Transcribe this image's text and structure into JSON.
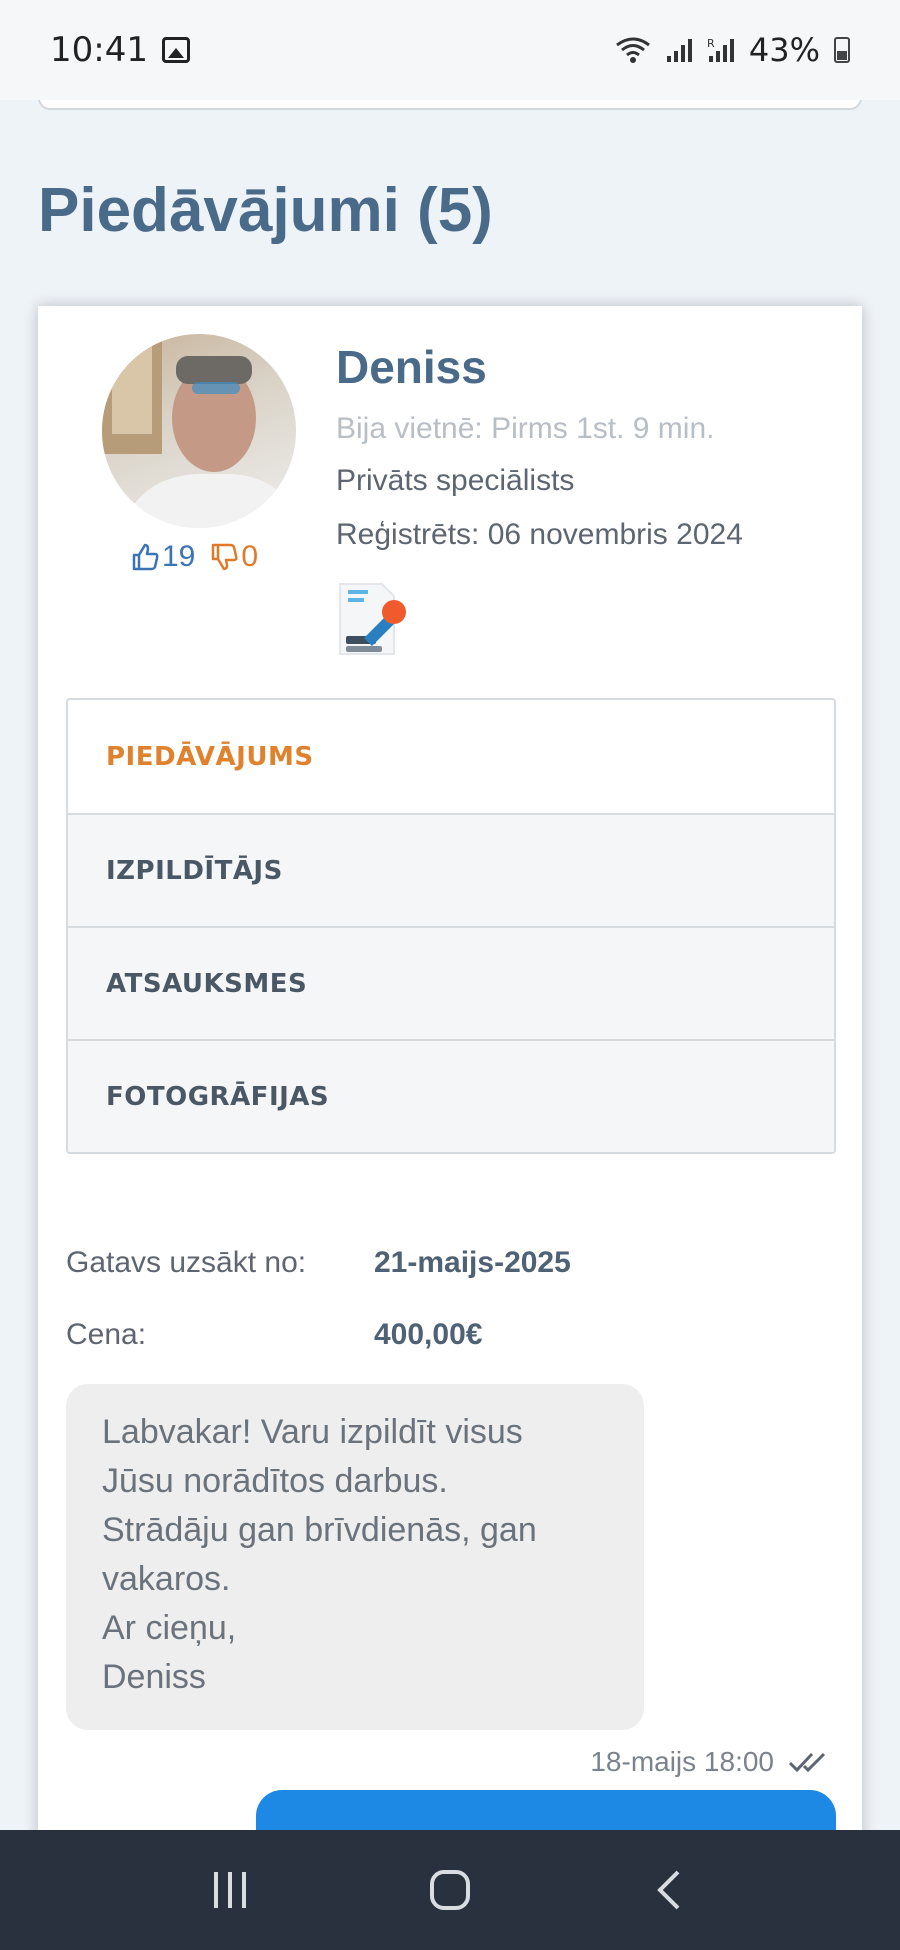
{
  "status_bar": {
    "time": "10:41",
    "battery": "43%"
  },
  "section": {
    "title": "Piedāvājumi (5)"
  },
  "offer": {
    "user": {
      "name": "Deniss",
      "last_seen": "Bija vietnē: Pirms 1st. 9 min.",
      "type": "Privāts speciālists",
      "registered": "Reģistrēts: 06 novembris 2024",
      "likes": "19",
      "dislikes": "0"
    },
    "tabs": [
      {
        "label": "PIEDĀVĀJUMS",
        "active": true
      },
      {
        "label": "IZPILDĪTĀJS",
        "active": false
      },
      {
        "label": "ATSAUKSMES",
        "active": false
      },
      {
        "label": "FOTOGRĀFIJAS",
        "active": false
      }
    ],
    "details": {
      "start_label": "Gatavs uzsākt no:",
      "start_value": "21-maijs-2025",
      "price_label": "Cena:",
      "price_value": "400,00€"
    },
    "message": {
      "text": "Labvakar! Varu izpildīt visus\nJūsu norādītos darbus.\nStrādāju gan brīvdienās, gan\nvakaros.\nAr cieņu,\nDeniss",
      "timestamp": "18-maijs 18:00"
    }
  },
  "colors": {
    "accent": "#e0812e",
    "title": "#4a6a8a",
    "outgoing": "#1e88e5"
  }
}
